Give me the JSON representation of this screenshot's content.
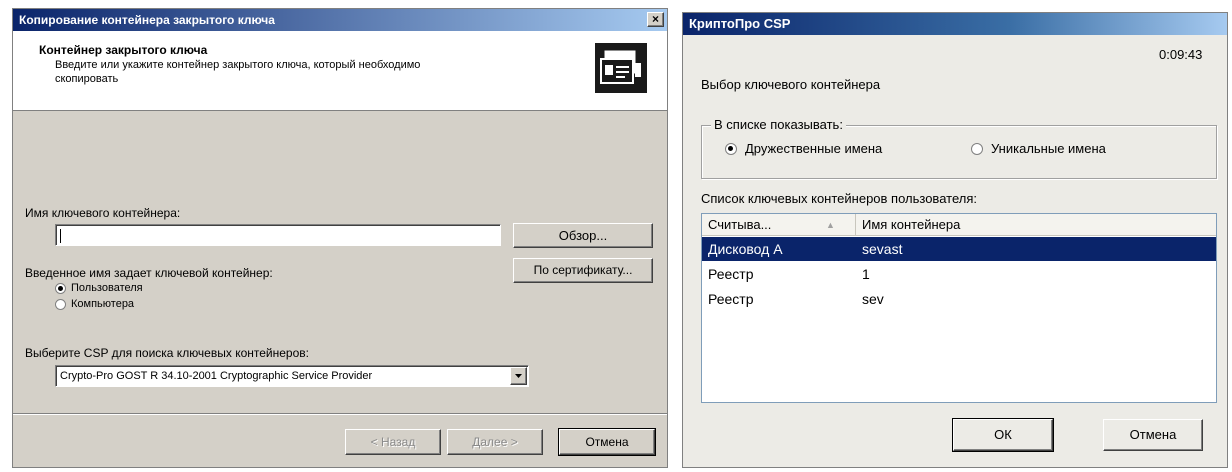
{
  "left_dialog": {
    "title": "Копирование контейнера закрытого ключа",
    "header_title": "Контейнер закрытого ключа",
    "header_desc_1": "Введите или укажите контейнер закрытого ключа, который необходимо",
    "header_desc_2": "скопировать",
    "key_container_label": "Имя ключевого контейнера:",
    "key_container_value": "",
    "browse_button": "Обзор...",
    "by_cert_button": "По сертификату...",
    "scope_label": "Введенное имя задает ключевой контейнер:",
    "scope_options": [
      {
        "label": "Пользователя",
        "checked": true
      },
      {
        "label": "Компьютера",
        "checked": false
      }
    ],
    "csp_label": "Выберите CSP для поиска ключевых контейнеров:",
    "csp_selected": "Crypto-Pro GOST R 34.10-2001 Cryptographic Service Provider",
    "back_button": "< Назад",
    "next_button": "Далее >",
    "cancel_button": "Отмена",
    "title_color": "#0a246a"
  },
  "right_dialog": {
    "title": "КриптоПро CSP",
    "timer": "0:09:43",
    "heading": "Выбор ключевого контейнера",
    "show_group_label": "В списке показывать:",
    "show_options": [
      {
        "label": "Дружественные имена",
        "checked": true
      },
      {
        "label": "Уникальные имена",
        "checked": false
      }
    ],
    "list_label": "Список ключевых контейнеров пользователя:",
    "columns": [
      "Считыва...",
      "Имя контейнера"
    ],
    "rows": [
      {
        "reader": "Дисковод А",
        "name": "sevast",
        "selected": true
      },
      {
        "reader": "Реестр",
        "name": "1",
        "selected": false
      },
      {
        "reader": "Реестр",
        "name": "sev",
        "selected": false
      }
    ],
    "ok_button": "ОК",
    "cancel_button": "Отмена",
    "selection_color": "#0a246a"
  }
}
